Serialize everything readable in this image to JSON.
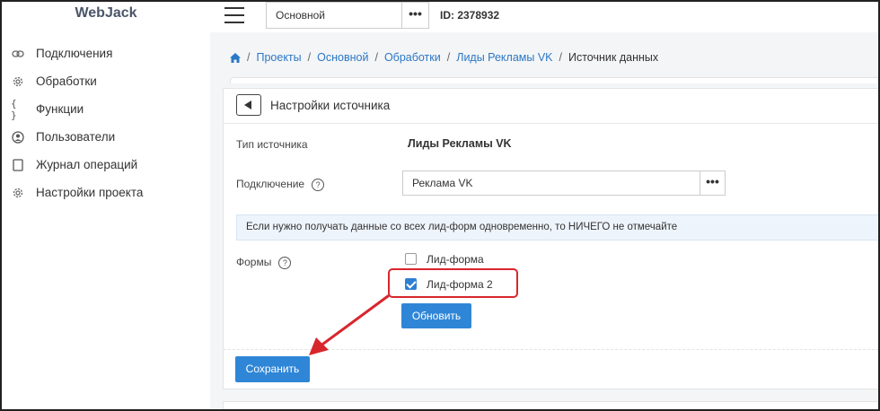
{
  "brand": "WebJack",
  "sidebar": {
    "items": [
      {
        "label": "Подключения",
        "icon": "link-icon"
      },
      {
        "label": "Обработки",
        "icon": "gear-icon"
      },
      {
        "label": "Функции",
        "icon": "braces-icon"
      },
      {
        "label": "Пользователи",
        "icon": "user-icon"
      },
      {
        "label": "Журнал операций",
        "icon": "journal-icon"
      },
      {
        "label": "Настройки проекта",
        "icon": "settings-icon"
      }
    ]
  },
  "topbar": {
    "project": "Основной",
    "dots": "•••",
    "id_text": "ID: 2378932"
  },
  "breadcrumb": {
    "items": [
      "Проекты",
      "Основной",
      "Обработки",
      "Лиды Рекламы VK"
    ],
    "current": "Источник данных",
    "separator": "/"
  },
  "card": {
    "title": "Настройки источника",
    "source_type_label": "Тип источника",
    "source_type_value": "Лиды Рекламы VK",
    "connection_label": "Подключение",
    "connection_value": "Реклама VK",
    "connection_dots": "•••",
    "help": "?",
    "info": "Если нужно получать данные со всех лид-форм одновременно, то НИЧЕГО не отмечайте",
    "forms_label": "Формы",
    "forms": [
      {
        "label": "Лид-форма",
        "checked": false
      },
      {
        "label": "Лид-форма 2",
        "checked": true
      }
    ],
    "refresh_button": "Обновить",
    "save_button": "Сохранить"
  },
  "colors": {
    "accent": "#2f86d6",
    "highlight": "#d8262d"
  }
}
